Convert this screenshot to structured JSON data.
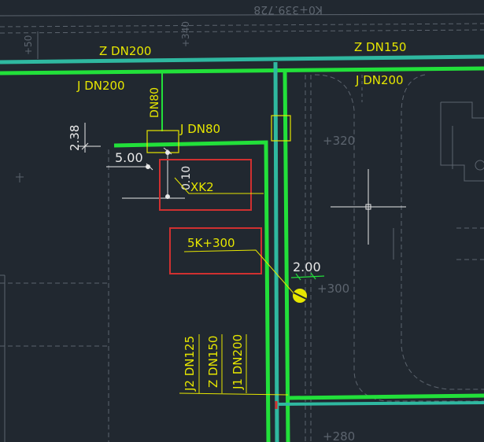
{
  "drawing": {
    "background_color": "#212830",
    "colors": {
      "pipe_green": "#22e03a",
      "pipe_teal": "#2fb8a0",
      "annotation_yellow": "#e6e600",
      "dim_white": "#e8e8e8",
      "highlight_red": "#d03030",
      "base_gray": "#5c646e"
    },
    "labels": {
      "top_station": "K0+339.728",
      "main_z_left": "Z DN200",
      "main_z_right": "Z DN150",
      "main_j_left": "J DN200",
      "main_j_right": "J DN200",
      "branch_vertical": "DN80",
      "branch_j": "J DN80",
      "dim_238": "2.38",
      "dim_500": "5.00",
      "dim_010": "0.10",
      "hydrant": "XK2",
      "station_mark": "5K+300",
      "dim_200": "2.00",
      "pipe_j2": "J2 DN125",
      "pipe_z": "Z DN150",
      "pipe_j1": "J1 DN200",
      "grade_top": "+320",
      "grade_mid": "+300",
      "grade_bottom": "+280",
      "faint_left": "+50",
      "faint_top": "+340"
    },
    "icons": {
      "crosshair": "cad-crosshair-cursor-icon",
      "valve": "hydrant-valve-icon"
    }
  }
}
